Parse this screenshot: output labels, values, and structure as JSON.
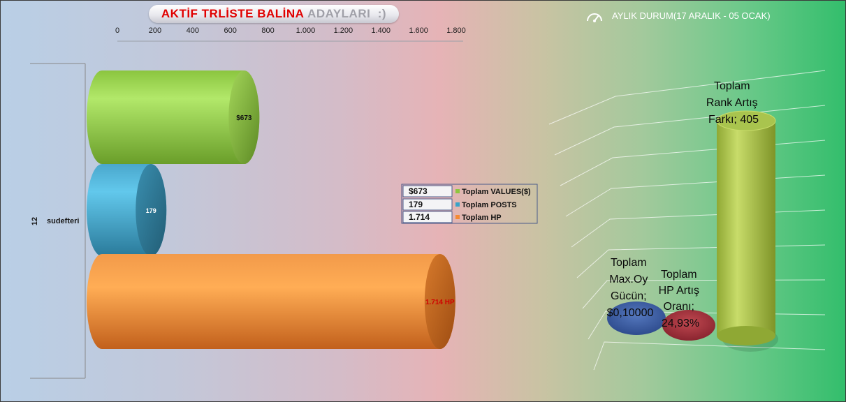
{
  "title": {
    "part1": "AKTİF TRLİSTE",
    "part2": " BALİNA",
    "part3": " ADAYLARI  :)"
  },
  "colors": {
    "values": "#8ec63f",
    "posts": "#3aa3c8",
    "hp": "#f58a34",
    "maxoy": "#3a5ea8",
    "hprate": "#a8323a",
    "rank": "#b4c54a"
  },
  "chart_data": [
    {
      "type": "bar",
      "orientation": "horizontal",
      "title": "",
      "xlim": [
        0,
        1800
      ],
      "x_ticks": [
        "0",
        "200",
        "400",
        "600",
        "800",
        "1.000",
        "1.200",
        "1.400",
        "1.600",
        "1.800"
      ],
      "category_group": "12",
      "categories": [
        "sudefteri"
      ],
      "series": [
        {
          "name": "Toplam VALUES($)",
          "values": [
            673
          ],
          "data_label": "$673",
          "legend_value": "$673"
        },
        {
          "name": "Toplam POSTS",
          "values": [
            179
          ],
          "data_label": "179",
          "legend_value": "179"
        },
        {
          "name": "Toplam HP",
          "values": [
            1714
          ],
          "data_label": "1.714 HP",
          "legend_value": "1.714"
        }
      ],
      "legend": "center-right"
    },
    {
      "type": "bar",
      "title": "AYLIK DURUM(17 ARALIK - 05 OCAK)",
      "icon": "gauge-icon",
      "series": [
        {
          "name": "Toplam Max.Oy Gücün",
          "value": 0.1,
          "label": [
            "Toplam",
            "Max.Oy",
            "Gücün;",
            "$0,10000"
          ]
        },
        {
          "name": "Toplam HP Artış Oranı",
          "value": 24.93,
          "label": [
            "Toplam",
            "HP Artış",
            "Oranı;",
            "24,93%"
          ]
        },
        {
          "name": "Toplam Rank Artış Farkı",
          "value": 405,
          "label": [
            "Toplam",
            "Rank Artış",
            "Farkı; 405"
          ]
        }
      ]
    }
  ]
}
